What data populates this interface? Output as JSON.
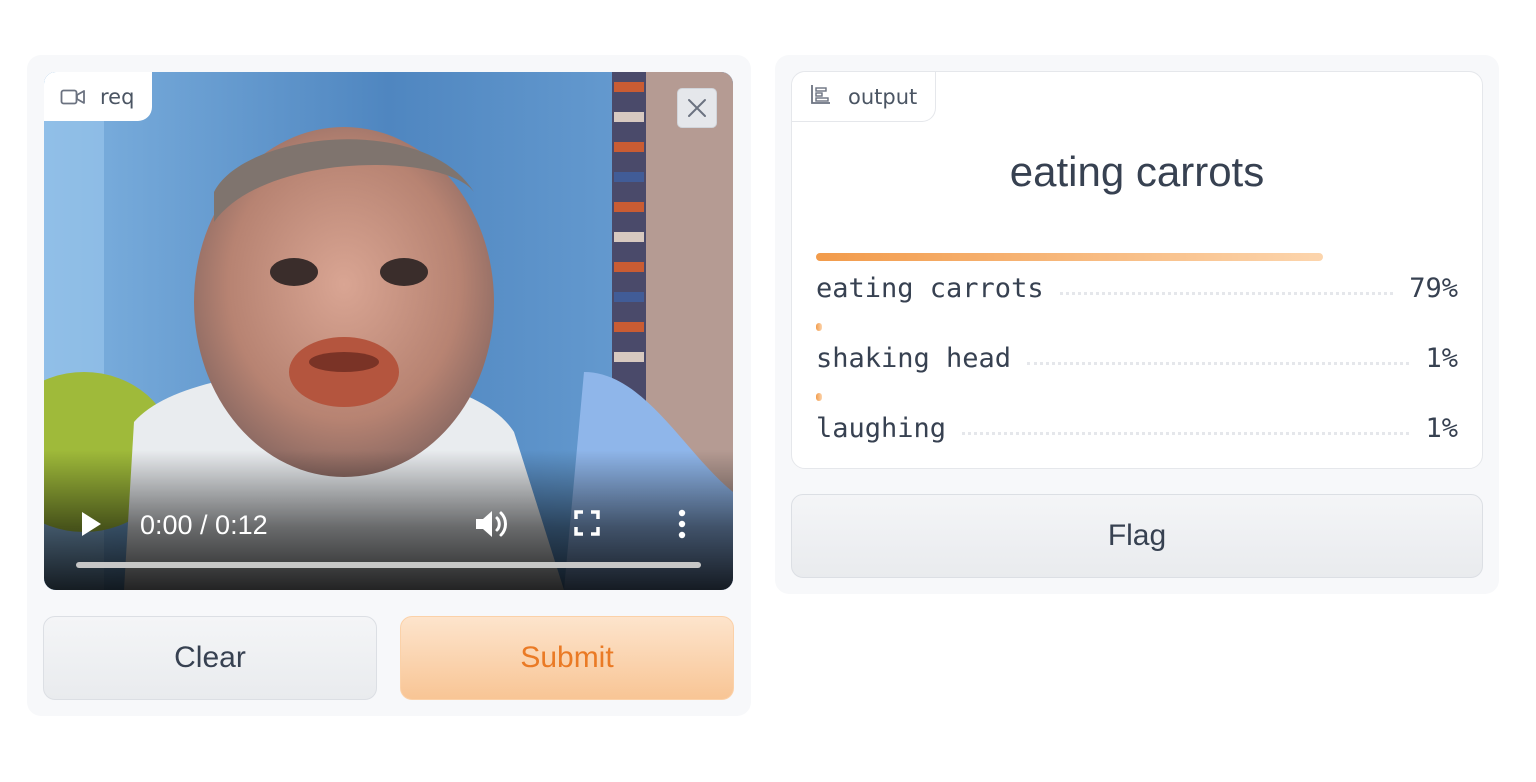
{
  "input": {
    "label": "req",
    "label_icon": "video-camera-icon",
    "player": {
      "time": "0:00 / 0:12",
      "progress": 0.0
    }
  },
  "buttons": {
    "clear": "Clear",
    "submit": "Submit",
    "flag": "Flag"
  },
  "output": {
    "label": "output",
    "label_icon": "bar-chart-icon",
    "top_label": "eating carrots",
    "confidences": [
      {
        "label": "eating carrots",
        "percent_text": "79%",
        "value": 0.79
      },
      {
        "label": "shaking head",
        "percent_text": "1%",
        "value": 0.01
      },
      {
        "label": "laughing",
        "percent_text": "1%",
        "value": 0.01
      }
    ]
  },
  "colors": {
    "accent": "#f29b4b",
    "submit_text": "#ea7a25",
    "panel_bg": "#f7f8fa"
  }
}
